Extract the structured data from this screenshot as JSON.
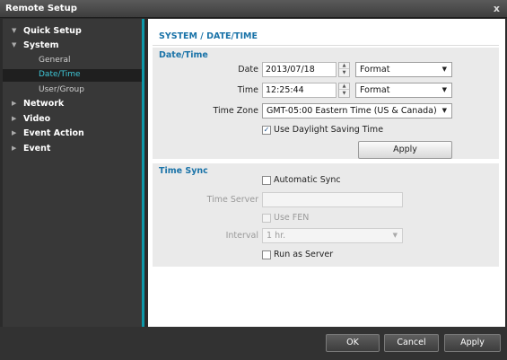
{
  "window": {
    "title": "Remote Setup",
    "close_label": "x"
  },
  "sidebar": {
    "items": [
      {
        "label": "Quick Setup",
        "expanded": true
      },
      {
        "label": "System",
        "expanded": true
      },
      {
        "label": "Network",
        "expanded": false
      },
      {
        "label": "Video",
        "expanded": false
      },
      {
        "label": "Event Action",
        "expanded": false
      },
      {
        "label": "Event",
        "expanded": false
      }
    ],
    "system_sub": [
      "General",
      "Date/Time",
      "User/Group"
    ],
    "active": "Date/Time"
  },
  "page": {
    "title": "SYSTEM / DATE/TIME"
  },
  "datetime": {
    "group_title": "Date/Time",
    "date_label": "Date",
    "date_value": "2013/07/18",
    "date_format": "Format",
    "time_label": "Time",
    "time_value": "12:25:44",
    "time_format": "Format",
    "timezone_label": "Time Zone",
    "timezone_value": "GMT-05:00 Eastern Time (US & Canada)",
    "dst_label": "Use Daylight Saving Time",
    "dst_checked": true,
    "apply_label": "Apply"
  },
  "timesync": {
    "group_title": "Time Sync",
    "auto_label": "Automatic Sync",
    "auto_checked": false,
    "server_label": "Time Server",
    "server_value": "",
    "fen_label": "Use FEN",
    "interval_label": "Interval",
    "interval_value": "1 hr.",
    "run_server_label": "Run as Server",
    "run_server_checked": false
  },
  "footer": {
    "ok_label": "OK",
    "cancel_label": "Cancel",
    "apply_label": "Apply"
  },
  "colors": {
    "accent": "#0d97a8",
    "title_blue": "#1a73a8",
    "active_text": "#3fc6d6"
  },
  "icons": {
    "expanded": "triangle-down-icon",
    "collapsed": "triangle-right-icon",
    "check": "checkmark-icon",
    "close": "close-icon"
  }
}
